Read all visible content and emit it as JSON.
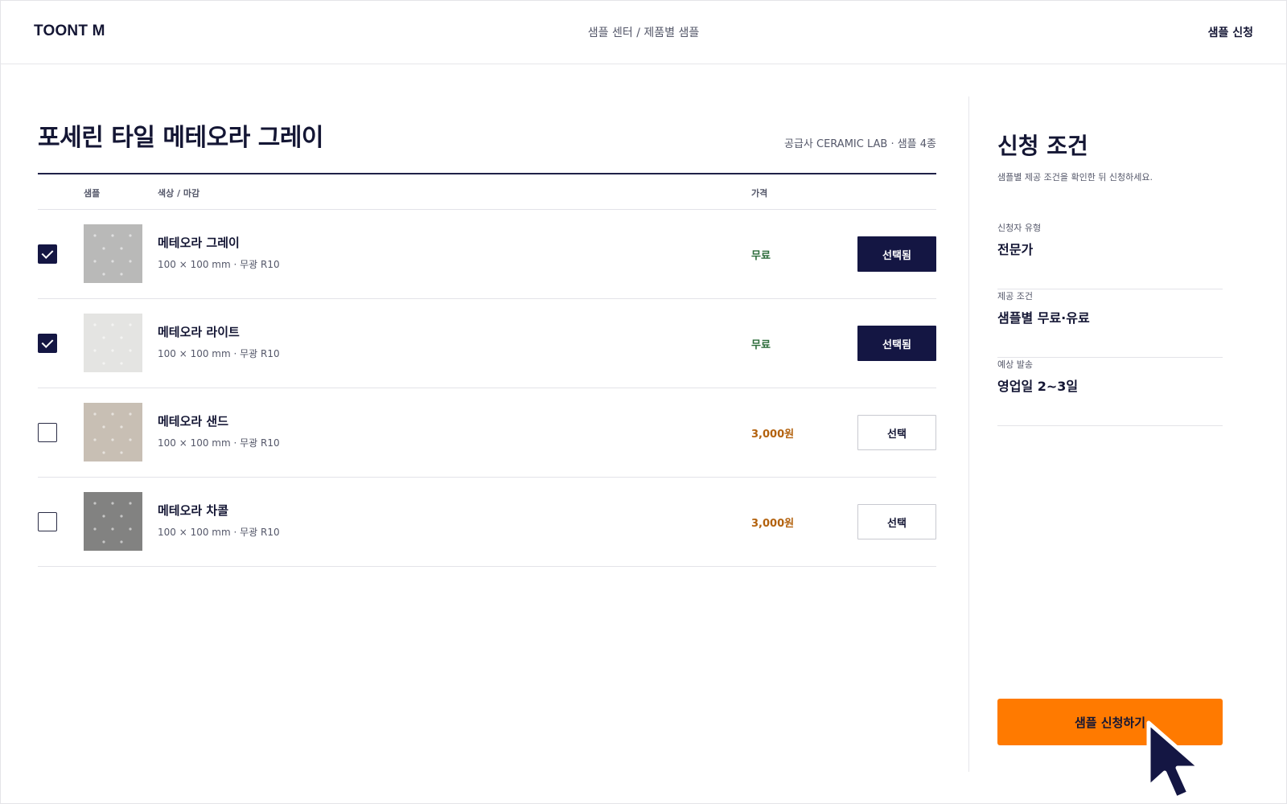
{
  "header": {
    "logo": "TOONT M",
    "breadcrumb": "샘플 센터 / 제품별 샘플",
    "action_link": "샘플 신청"
  },
  "product": {
    "title": "포세린 타일 메테오라 그레이",
    "supplier_info": "공급사 CERAMIC LAB · 샘플 4종"
  },
  "table": {
    "headers": {
      "sample": "샘플",
      "color_finish": "색상 / 마감",
      "price": "가격"
    },
    "rows": [
      {
        "name": "메테오라 그레이",
        "spec": "100 × 100 mm · 무광 R10",
        "price": "무료",
        "price_type": "free",
        "button": "선택됨",
        "selected": true,
        "swatch": "#b9b9b8"
      },
      {
        "name": "메테오라 라이트",
        "spec": "100 × 100 mm · 무광 R10",
        "price": "무료",
        "price_type": "free",
        "button": "선택됨",
        "selected": true,
        "swatch": "#e4e4e2"
      },
      {
        "name": "메테오라 샌드",
        "spec": "100 × 100 mm · 무광 R10",
        "price": "3,000원",
        "price_type": "paid",
        "button": "선택",
        "selected": false,
        "swatch": "#c8bfb4"
      },
      {
        "name": "메테오라 차콜",
        "spec": "100 × 100 mm · 무광 R10",
        "price": "3,000원",
        "price_type": "paid",
        "button": "선택",
        "selected": false,
        "swatch": "#828281"
      }
    ]
  },
  "side_panel": {
    "title": "신청 조건",
    "description": "샘플별 제공 조건을 확인한 뒤 신청하세요.",
    "conditions": [
      {
        "label": "신청자 유형",
        "value": "전문가"
      },
      {
        "label": "제공 조건",
        "value": "샘플별 무료·유료"
      },
      {
        "label": "예상 발송",
        "value": "영업일 2~3일"
      }
    ],
    "apply_button": "샘플 신청하기"
  },
  "colors": {
    "navy": "#141643",
    "accent_orange": "#ff7a00",
    "free_green": "#2b6b3a",
    "paid_orange": "#b3620e"
  }
}
